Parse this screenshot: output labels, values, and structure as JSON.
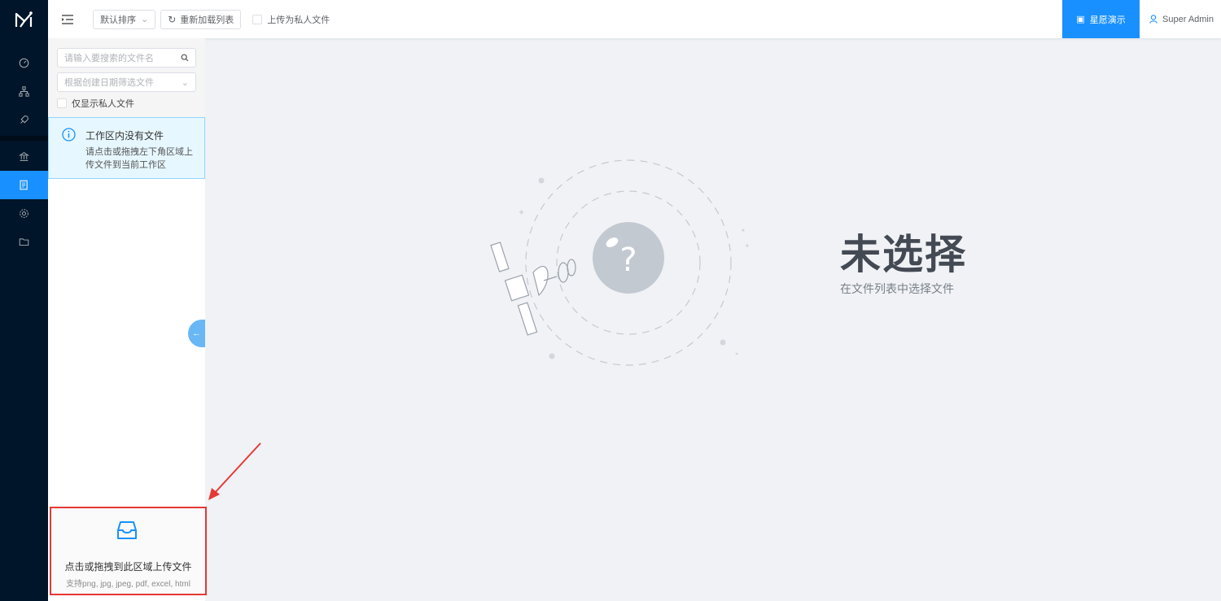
{
  "topbar": {
    "sort_label": "默认排序",
    "reload_label": "重新加载列表",
    "private_upload_label": "上传为私人文件",
    "demo_label": "星愿演示",
    "user_name": "Super Admin"
  },
  "panel": {
    "search_placeholder": "请输入要搜索的文件名",
    "date_placeholder": "根据创建日期筛选文件",
    "only_private_label": "仅显示私人文件",
    "alert_title": "工作区内没有文件",
    "alert_desc": "请点击或拖拽左下角区域上传文件到当前工作区"
  },
  "upload": {
    "text": "点击或拖拽到此区域上传文件",
    "hint": "支持png, jpg, jpeg, pdf, excel, html"
  },
  "main": {
    "empty_title": "未选择",
    "empty_subtitle": "在文件列表中选择文件"
  },
  "colors": {
    "nav_bg": "#001529",
    "accent": "#1890ff",
    "highlight_border": "#e53935"
  }
}
